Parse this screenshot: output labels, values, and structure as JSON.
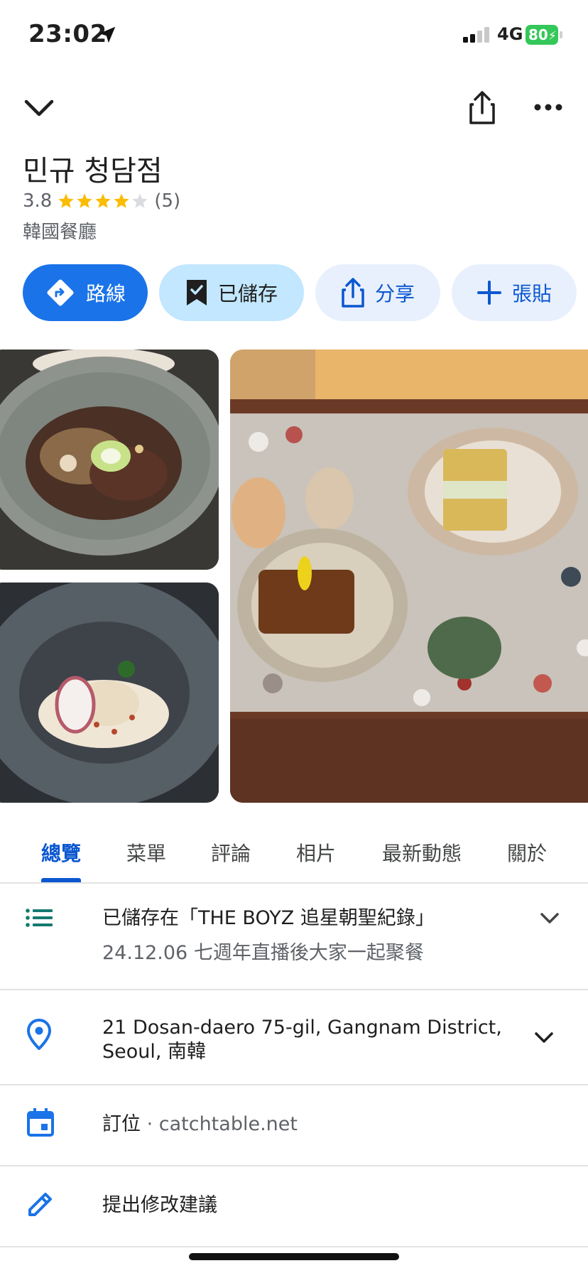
{
  "status_bar": {
    "time": "23:02",
    "network": "4G",
    "battery": "80"
  },
  "place": {
    "name": "민규 청담점",
    "rating": "3.8",
    "rating_value": 3.8,
    "review_count": "(5)",
    "category": "韓國餐廳"
  },
  "actions": {
    "route": "路線",
    "saved": "已儲存",
    "share": "分享",
    "sticker": "張貼"
  },
  "tabs": [
    "總覽",
    "菜單",
    "評論",
    "相片",
    "最新動態",
    "關於"
  ],
  "active_tab": "總覽",
  "saved_list": {
    "title": "已儲存在「THE BOYZ 追星朝聖紀錄」",
    "note": "24.12.06 七週年直播後大家一起聚餐"
  },
  "address": {
    "line1": "21 Dosan-daero 75-gil, Gangnam District,",
    "line2": "Seoul, 南韓"
  },
  "reservation": {
    "label": "訂位",
    "separator": " · ",
    "site": "catchtable.net"
  },
  "suggest_edit": {
    "label": "提出修改建議"
  },
  "icons": [
    "location-arrow-icon",
    "chevron-down-icon",
    "share-icon",
    "more-icon",
    "directions-icon",
    "bookmark-check-icon",
    "plus-icon",
    "list-icon",
    "pin-icon",
    "calendar-icon",
    "pencil-icon"
  ],
  "colors": {
    "primary": "#1a73e8",
    "tab_active": "#0b57d0",
    "star": "#fbbc04",
    "battery": "#34c759"
  }
}
